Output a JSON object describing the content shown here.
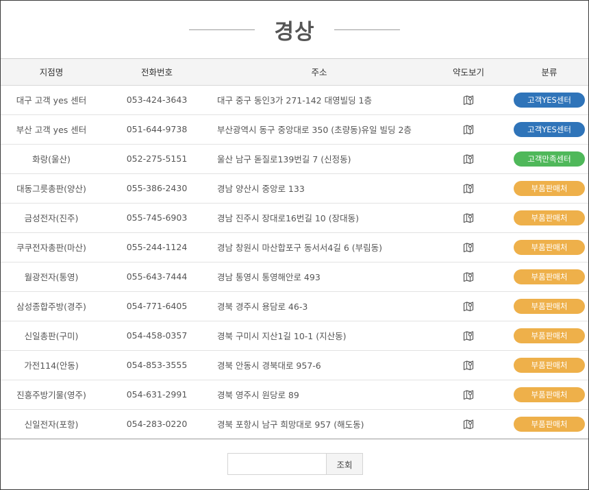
{
  "header": {
    "title": "경상"
  },
  "table": {
    "columns": {
      "name": "지점명",
      "phone": "전화번호",
      "address": "주소",
      "map": "약도보기",
      "category": "분류"
    },
    "rows": [
      {
        "name": "대구 고객 yes 센터",
        "phone": "053-424-3643",
        "address": "대구 중구 동인3가 271-142 대영빌딩 1층",
        "category": "고객YES센터",
        "color": "blue"
      },
      {
        "name": "부산 고객 yes 센터",
        "phone": "051-644-9738",
        "address": "부산광역시 동구 중앙대로 350 (초량동)유일 빌딩 2층",
        "category": "고객YES센터",
        "color": "blue"
      },
      {
        "name": "화랑(울산)",
        "phone": "052-275-5151",
        "address": "울산 남구 돋질로139번길 7 (신정동)",
        "category": "고객만족센터",
        "color": "green"
      },
      {
        "name": "대동그릇총판(양산)",
        "phone": "055-386-2430",
        "address": "경남 양산시 중앙로 133",
        "category": "부품판매처",
        "color": "orange"
      },
      {
        "name": "금성전자(진주)",
        "phone": "055-745-6903",
        "address": "경남 진주시 장대로16번길 10 (장대동)",
        "category": "부품판매처",
        "color": "orange"
      },
      {
        "name": "쿠쿠전자총판(마산)",
        "phone": "055-244-1124",
        "address": "경남 창원시 마산합포구 동서서4길 6 (부림동)",
        "category": "부품판매처",
        "color": "orange"
      },
      {
        "name": "월광전자(통영)",
        "phone": "055-643-7444",
        "address": "경남 통영시 통영해안로 493",
        "category": "부품판매처",
        "color": "orange"
      },
      {
        "name": "삼성종합주방(경주)",
        "phone": "054-771-6405",
        "address": "경북 경주시 용담로 46-3",
        "category": "부품판매처",
        "color": "orange"
      },
      {
        "name": "신일총판(구미)",
        "phone": "054-458-0357",
        "address": "경북 구미시 지산1길 10-1 (지산동)",
        "category": "부품판매처",
        "color": "orange"
      },
      {
        "name": "가전114(안동)",
        "phone": "054-853-3555",
        "address": "경북 안동시 경북대로 957-6",
        "category": "부품판매처",
        "color": "orange"
      },
      {
        "name": "진흥주방기물(영주)",
        "phone": "054-631-2991",
        "address": "경북 영주시 원당로 89",
        "category": "부품판매처",
        "color": "orange"
      },
      {
        "name": "신일전자(포항)",
        "phone": "054-283-0220",
        "address": "경북 포항시 남구 희망대로 957 (해도동)",
        "category": "부품판매처",
        "color": "orange"
      }
    ]
  },
  "search": {
    "value": "",
    "button_label": "조회"
  },
  "icons": {
    "map": "map-icon"
  },
  "colors": {
    "blue": "#2f74b9",
    "green": "#4fb85a",
    "orange": "#eeb04a"
  }
}
